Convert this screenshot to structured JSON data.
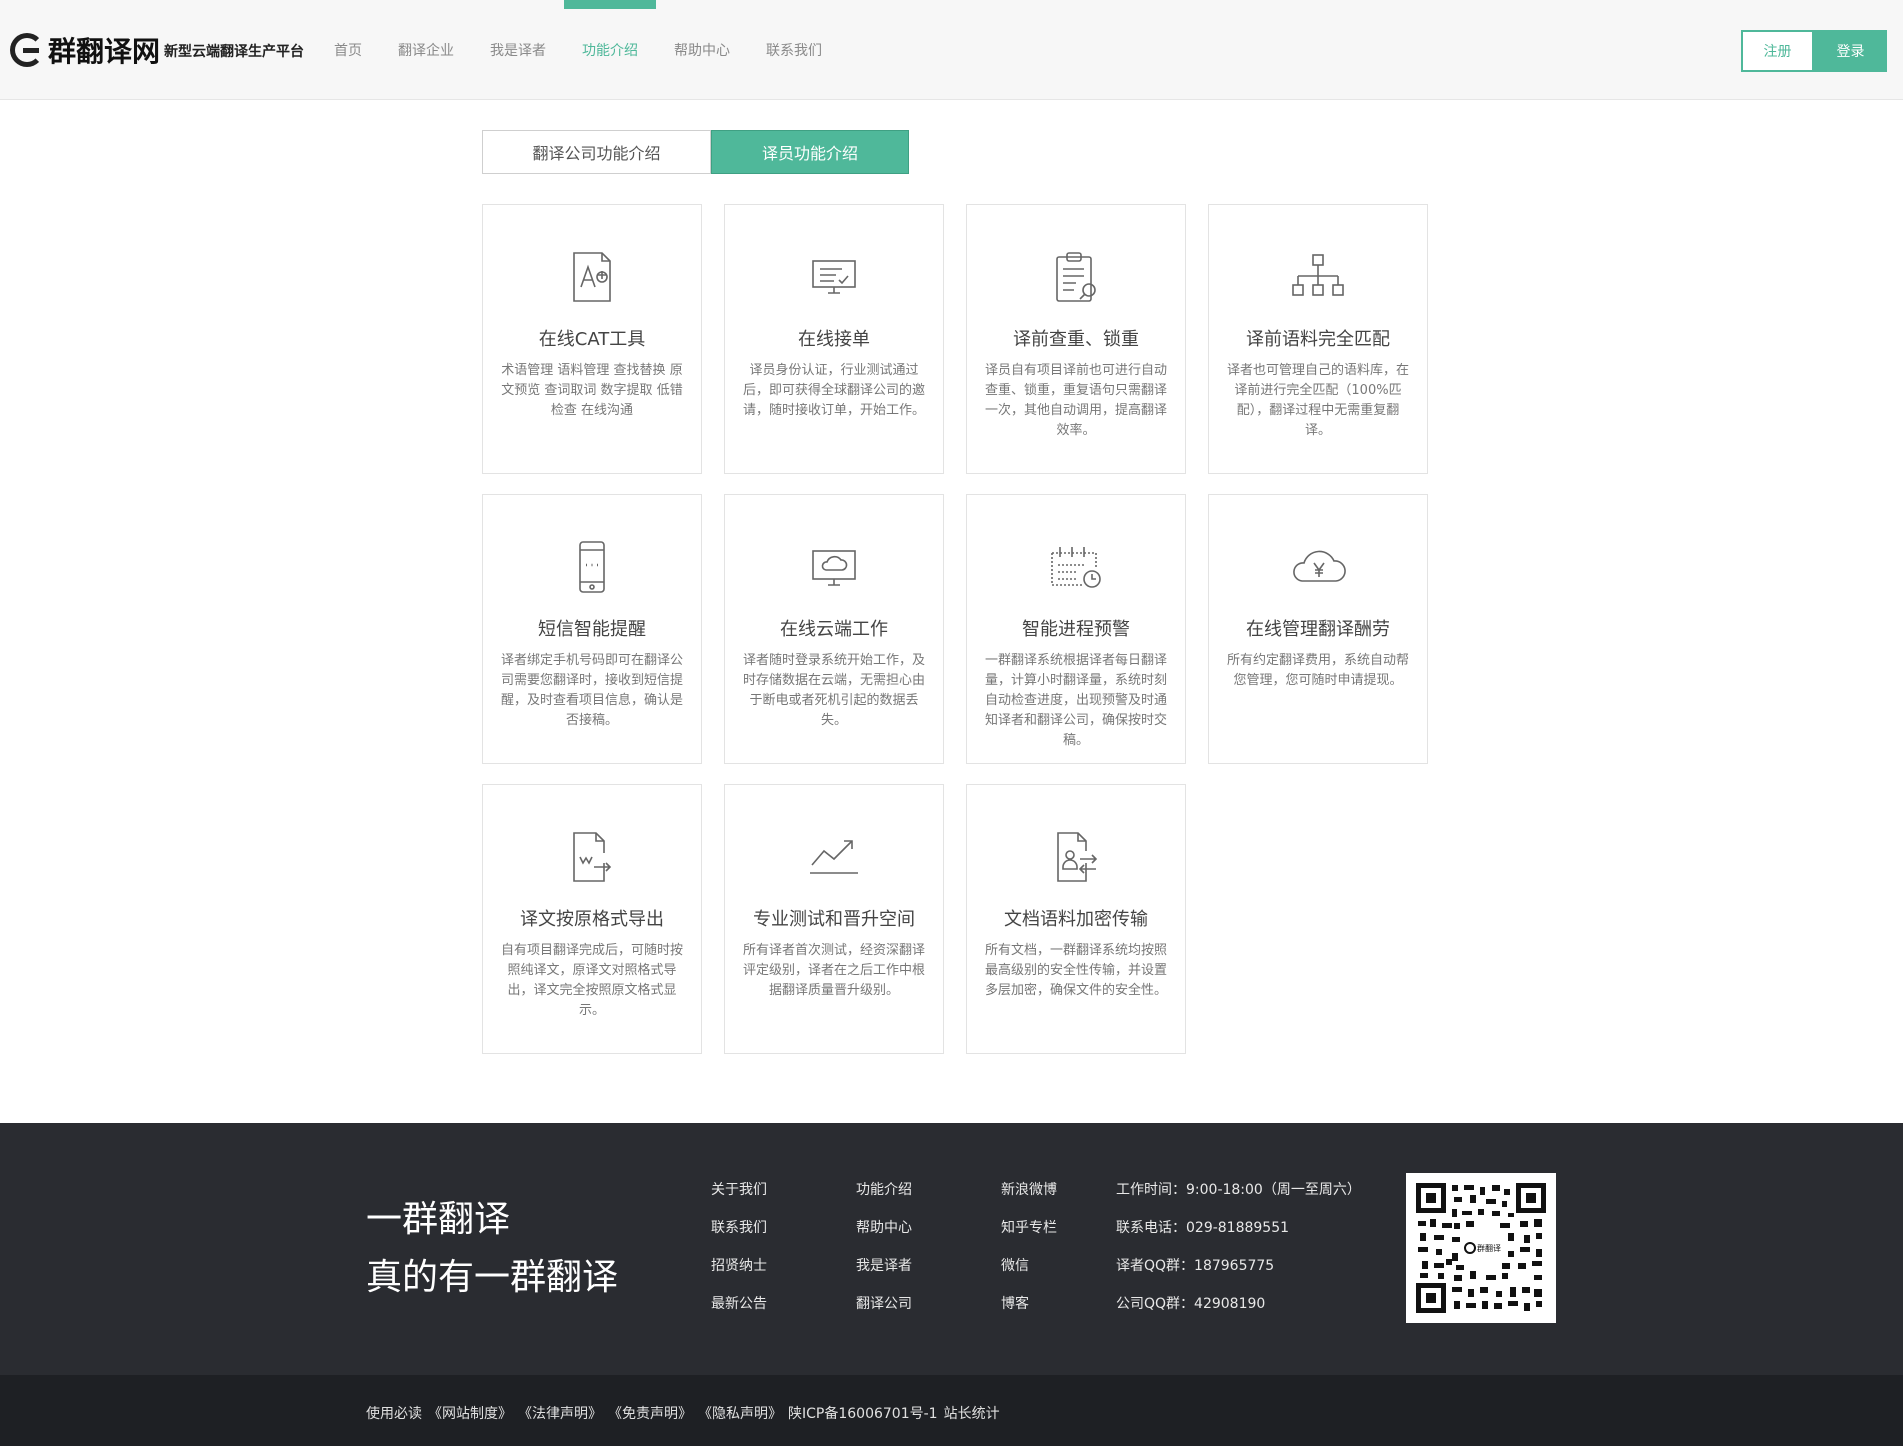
{
  "header": {
    "logo_text": "群翻译网",
    "slogan": "新型云端翻译生产平台",
    "nav": [
      {
        "label": "首页"
      },
      {
        "label": "翻译企业"
      },
      {
        "label": "我是译者"
      },
      {
        "label": "功能介绍"
      },
      {
        "label": "帮助中心"
      },
      {
        "label": "联系我们"
      }
    ],
    "active_nav": "功能介绍",
    "register_label": "注册",
    "login_label": "登录"
  },
  "tabs": {
    "company": "翻译公司功能介绍",
    "translator": "译员功能介绍",
    "active": "译员功能介绍"
  },
  "features": [
    {
      "icon": "cat-tool-icon",
      "title": "在线CAT工具",
      "desc": "术语管理 语料管理 查找替换 原文预览 查词取词 数字提取 低错检查 在线沟通"
    },
    {
      "icon": "monitor-check-icon",
      "title": "在线接单",
      "desc": "译员身份认证，行业测试通过后，即可获得全球翻译公司的邀请，随时接收订单，开始工作。"
    },
    {
      "icon": "clipboard-search-icon",
      "title": "译前查重、锁重",
      "desc": "译员自有项目译前也可进行自动查重、锁重，重复语句只需翻译一次，其他自动调用，提高翻译效率。"
    },
    {
      "icon": "hierarchy-icon",
      "title": "译前语料完全匹配",
      "desc": "译者也可管理自己的语料库，在译前进行完全匹配（100%匹配），翻译过程中无需重复翻译。"
    },
    {
      "icon": "mobile-phone-icon",
      "title": "短信智能提醒",
      "desc": "译者绑定手机号码即可在翻译公司需要您翻译时，接收到短信提醒，及时查看项目信息，确认是否接稿。"
    },
    {
      "icon": "monitor-cloud-icon",
      "title": "在线云端工作",
      "desc": "译者随时登录系统开始工作，及时存储数据在云端，无需担心由于断电或者死机引起的数据丢失。"
    },
    {
      "icon": "calendar-clock-icon",
      "title": "智能进程预警",
      "desc": "一群翻译系统根据译者每日翻译量，计算小时翻译量，系统时刻自动检查进度，出现预警及时通知译者和翻译公司，确保按时交稿。"
    },
    {
      "icon": "cloud-yen-icon",
      "title": "在线管理翻译酬劳",
      "desc": "所有约定翻译费用，系统自动帮您管理，您可随时申请提现。"
    },
    {
      "icon": "document-export-icon",
      "title": "译文按原格式导出",
      "desc": "自有项目翻译完成后，可随时按照纯译文，原译文对照格式导出，译文完全按照原文格式显示。"
    },
    {
      "icon": "trend-up-icon",
      "title": "专业测试和晋升空间",
      "desc": "所有译者首次测试，经资深翻译评定级别，译者在之后工作中根据翻译质量晋升级别。"
    },
    {
      "icon": "document-transfer-icon",
      "title": "文档语料加密传输",
      "desc": "所有文档，一群翻译系统均按照最高级别的安全性传输，并设置多层加密，确保文件的安全性。"
    }
  ],
  "footer": {
    "slogan_line1": "一群翻译",
    "slogan_line2": "真的有一群翻译",
    "links": [
      "关于我们",
      "功能介绍",
      "新浪微博",
      "联系我们",
      "帮助中心",
      "知乎专栏",
      "招贤纳士",
      "我是译者",
      "微信",
      "最新公告",
      "翻译公司",
      "博客"
    ],
    "contact": [
      "工作时间：9:00-18:00（周一至周六）",
      "联系电话：029-81889551",
      "译者QQ群：187965775",
      "公司QQ群：42908190"
    ],
    "qr_center_label": "群翻译"
  },
  "bottom": {
    "prefix": "使用必读",
    "links": [
      "《网站制度》",
      "《法律声明》",
      "《免责声明》",
      "《隐私声明》"
    ],
    "icp": "陕ICP备16006701号-1",
    "stats": "站长统计"
  },
  "colors": {
    "accent": "#4fb89a",
    "footer_bg": "#2a2c31",
    "bottom_bg": "#1e2024"
  }
}
